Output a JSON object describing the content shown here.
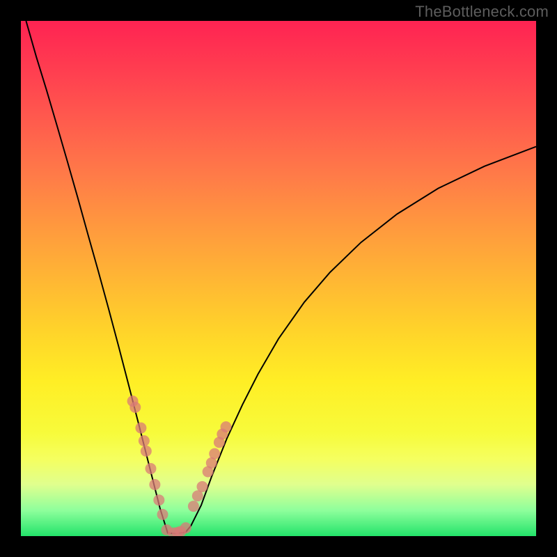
{
  "watermark_text": "TheBottleneck.com",
  "chart_data": {
    "type": "line",
    "title": "",
    "xlabel": "",
    "ylabel": "",
    "xlim": [
      0,
      100
    ],
    "ylim": [
      0,
      100
    ],
    "curve": {
      "name": "bottleneck-curve",
      "x": [
        1,
        3,
        5,
        7,
        9,
        11,
        13,
        15,
        17,
        19,
        21,
        23,
        25,
        27,
        28.5,
        30,
        31,
        32,
        33,
        35,
        37,
        40,
        43,
        46,
        50,
        55,
        60,
        66,
        73,
        81,
        90,
        100
      ],
      "y": [
        100,
        93,
        86.5,
        79.7,
        72.8,
        65.8,
        58.6,
        51.5,
        44.2,
        36.7,
        29.0,
        21.2,
        13.3,
        5.4,
        0.6,
        0.5,
        0.6,
        0.8,
        2.0,
        6.0,
        11.5,
        19.0,
        25.5,
        31.4,
        38.3,
        45.4,
        51.2,
        57.0,
        62.5,
        67.5,
        71.8,
        75.6
      ]
    },
    "dots": {
      "name": "highlight-dots",
      "x": [
        21.7,
        22.2,
        23.3,
        23.9,
        24.3,
        25.2,
        26.0,
        26.8,
        27.5,
        28.3,
        29.6,
        30.4,
        31.0,
        32.0,
        33.5,
        34.3,
        35.2,
        36.3,
        37.0,
        37.6,
        38.5,
        39.1,
        39.8
      ],
      "y": [
        26.2,
        25.0,
        21.0,
        18.5,
        16.5,
        13.1,
        10.0,
        7.0,
        4.2,
        1.2,
        0.6,
        0.7,
        0.9,
        1.6,
        5.8,
        7.8,
        9.6,
        12.5,
        14.2,
        16.0,
        18.2,
        19.8,
        21.2
      ],
      "radius": 8,
      "color": "#d97a77"
    }
  }
}
